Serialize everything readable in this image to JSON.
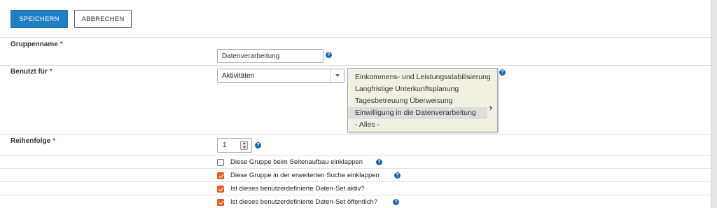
{
  "toolbar": {
    "save_label": "SPEICHERN",
    "cancel_label": "ABBRECHEN"
  },
  "form": {
    "group_name": {
      "label": "Gruppenname",
      "required_marker": "*",
      "value": "Datenverarbeitung"
    },
    "used_for": {
      "label": "Benutzt für",
      "required_marker": "*",
      "select_value": "Aktivitäten",
      "options": [
        "Einkommens- und Leistungsstabilisierung",
        "Langfristige Unterkunftsplanung",
        "Tagesbetreuung Überweisung",
        "Einwilligung in die Datenverarbeitung",
        "- Alles -"
      ],
      "selected_option": "Einwilligung in die Datenverarbeitung"
    },
    "order": {
      "label": "Reihenfolge",
      "required_marker": "*",
      "value": "1"
    },
    "checkboxes": [
      {
        "label": "Diese Gruppe beim Seitenaufbau einklappen",
        "checked": false,
        "help": true
      },
      {
        "label": "Diese Gruppe in der erweiterten Suche einklappen",
        "checked": true,
        "help": true
      },
      {
        "label": "Ist dieses benutzerdefinierte Daten-Set aktiv?",
        "checked": true,
        "help": false
      },
      {
        "label": "Ist dieses benutzerdefinierte Daten-Set öffentlich?",
        "checked": true,
        "help": true
      }
    ],
    "help_glyph": "?"
  },
  "colors": {
    "primary_button": "#1f7fc4",
    "checkbox_checked": "#e8602a",
    "required": "#cf2a2a",
    "help_icon": "#1c66b0"
  }
}
